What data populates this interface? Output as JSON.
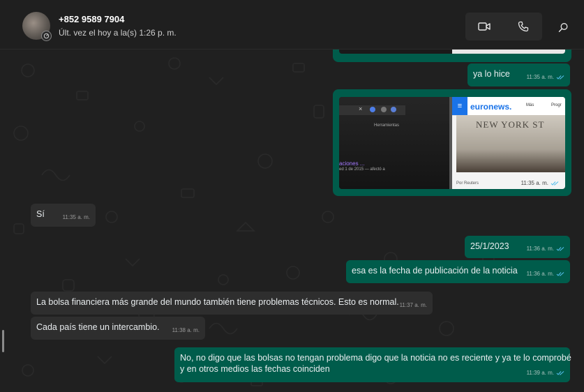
{
  "header": {
    "contact_name": "+852 9589 7904",
    "status": "Últ. vez el hoy a la(s) 1:26 p. m.",
    "icons": [
      "avatar",
      "status-ring-icon",
      "video-call-icon",
      "phone-call-icon",
      "search-icon"
    ]
  },
  "colors": {
    "header_bg": "#1f1f1f",
    "chat_bg": "#202020",
    "outgoing_bubble": "#005c4b",
    "incoming_bubble": "#2e2e2e",
    "read_ticks": "#53bdeb",
    "euronews_accent": "#1a73e8"
  },
  "messages": [
    {
      "id": "m0",
      "direction": "out",
      "type": "image",
      "partial": true
    },
    {
      "id": "m1",
      "direction": "out",
      "type": "text",
      "text": "ya lo hice",
      "time": "11:35 a. m.",
      "read": true
    },
    {
      "id": "m2",
      "direction": "out",
      "type": "image",
      "time": "11:35 a. m.",
      "read": true,
      "image": {
        "browser_hint": "Herramientas",
        "result_text": "aciones ...",
        "result_sub": "ed 1 de 2015 — afectó a",
        "site": "euronews.",
        "menu": "Más",
        "menu2": "Progr",
        "photo_text": "NEW YORK ST",
        "caption": "Por Reuters"
      }
    },
    {
      "id": "m3",
      "direction": "in",
      "type": "text",
      "text": "Sí",
      "time": "11:35 a. m."
    },
    {
      "id": "m4",
      "direction": "out",
      "type": "text",
      "text": "25/1/2023",
      "time": "11:36 a. m.",
      "read": true
    },
    {
      "id": "m5",
      "direction": "out",
      "type": "text",
      "text": "esa es la fecha de publicación de la noticia",
      "time": "11:36 a. m.",
      "read": true
    },
    {
      "id": "m6",
      "direction": "in",
      "type": "text",
      "text": "La bolsa financiera más grande del mundo también tiene problemas técnicos. Esto es normal.",
      "time": "11:37 a. m."
    },
    {
      "id": "m7",
      "direction": "in",
      "type": "text",
      "text": "Cada país tiene un intercambio.",
      "time": "11:38 a. m."
    },
    {
      "id": "m8",
      "direction": "out",
      "type": "text",
      "text_line1": "No, no digo que las bolsas no tengan problema digo que la noticia no es reciente y ya te lo comprobé",
      "text_line2": "y en otros medios las fechas coinciden",
      "time": "11:39 a. m.",
      "read": true
    }
  ]
}
